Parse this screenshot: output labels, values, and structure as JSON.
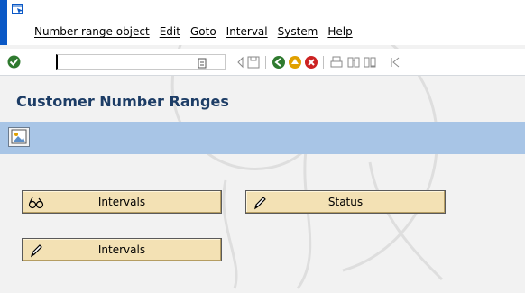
{
  "menubar": {
    "items": [
      {
        "label": "Number range object"
      },
      {
        "label": "Edit"
      },
      {
        "label": "Goto"
      },
      {
        "label": "Interval"
      },
      {
        "label": "System"
      },
      {
        "label": "Help"
      }
    ]
  },
  "toolbar": {
    "command_field_value": ""
  },
  "page": {
    "title": "Customer Number Ranges"
  },
  "buttons": {
    "intervals_display": "Intervals",
    "status": "Status",
    "intervals_change": "Intervals"
  },
  "colors": {
    "accent": "#0a58c6",
    "app_toolbar": "#a8c5e6",
    "button_bg": "#f3e1b4",
    "title": "#1d3d66"
  }
}
